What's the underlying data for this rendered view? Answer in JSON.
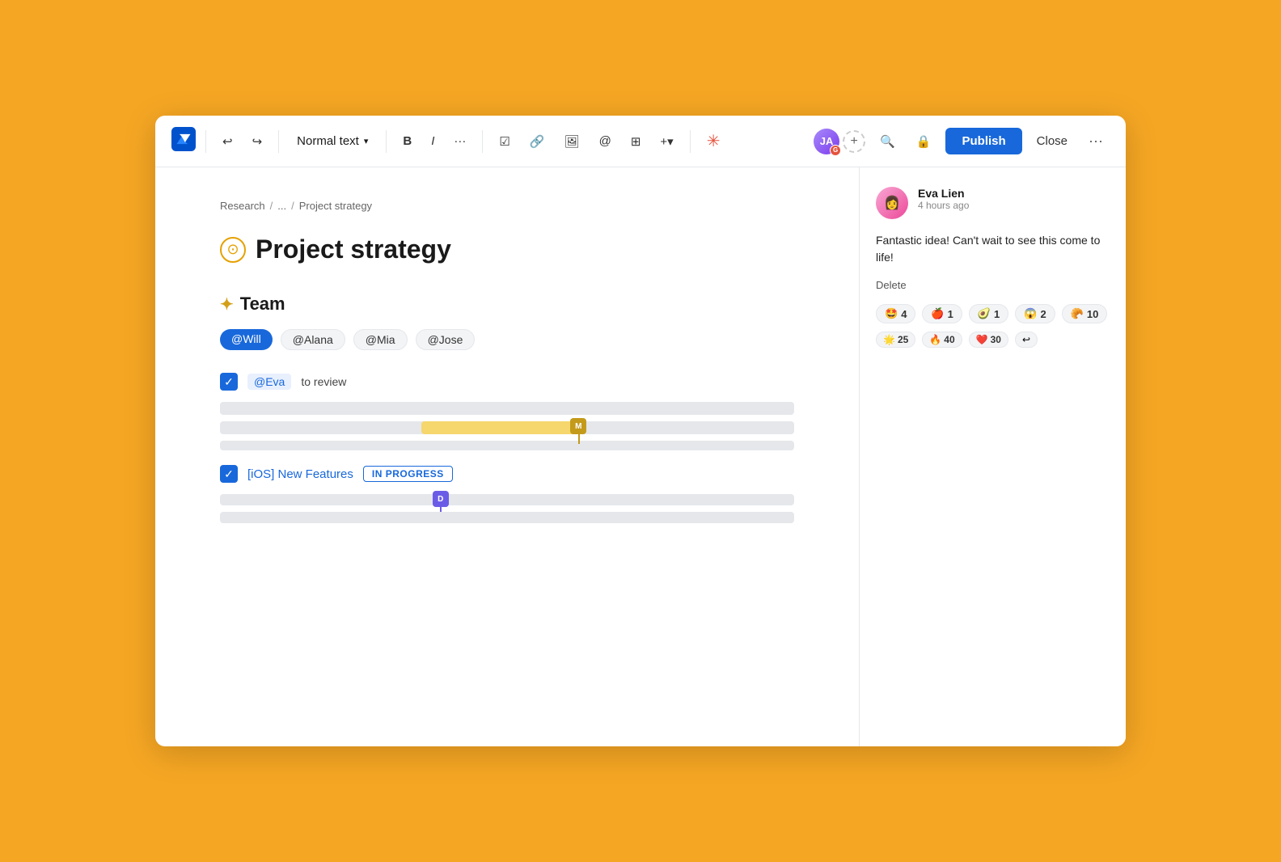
{
  "toolbar": {
    "normal_text_label": "Normal text",
    "publish_label": "Publish",
    "close_label": "Close",
    "undo_icon": "↩",
    "redo_icon": "↪",
    "bold_label": "B",
    "italic_label": "I",
    "more_label": "···",
    "task_icon": "☑",
    "link_icon": "🔗",
    "image_icon": "🖼",
    "mention_icon": "@",
    "table_icon": "⊞",
    "insert_label": "+▾",
    "ai_icon": "✳",
    "search_icon": "🔍",
    "lock_icon": "🔒",
    "more_icon": "···"
  },
  "breadcrumb": {
    "parts": [
      "Research",
      "/",
      "...",
      "/",
      "Project strategy"
    ]
  },
  "page": {
    "title": "Project strategy",
    "title_icon": "🕐"
  },
  "team_section": {
    "heading": "Team",
    "sparkle": "✦",
    "mentions": [
      "@Will",
      "@Alana",
      "@Mia",
      "@Jose"
    ]
  },
  "task1": {
    "mention": "@Eva",
    "text": "to review"
  },
  "task2": {
    "label": "[iOS] New Features",
    "status": "IN PROGRESS"
  },
  "comment": {
    "author": "Eva Lien",
    "time": "4 hours ago",
    "body": "Fantastic idea! Can't wait to see this come to life!",
    "delete_label": "Delete",
    "reactions": [
      {
        "emoji": "🤩",
        "count": "4"
      },
      {
        "emoji": "🍎",
        "count": "1"
      },
      {
        "emoji": "🥑",
        "count": "1"
      },
      {
        "emoji": "😱",
        "count": "2"
      },
      {
        "emoji": "🥐",
        "count": "10"
      }
    ],
    "reactions2": [
      {
        "emoji": "🌟",
        "count": "25"
      },
      {
        "emoji": "🔥",
        "count": "40"
      },
      {
        "emoji": "❤️",
        "count": "30"
      },
      {
        "emoji": "↩",
        "count": ""
      }
    ]
  }
}
